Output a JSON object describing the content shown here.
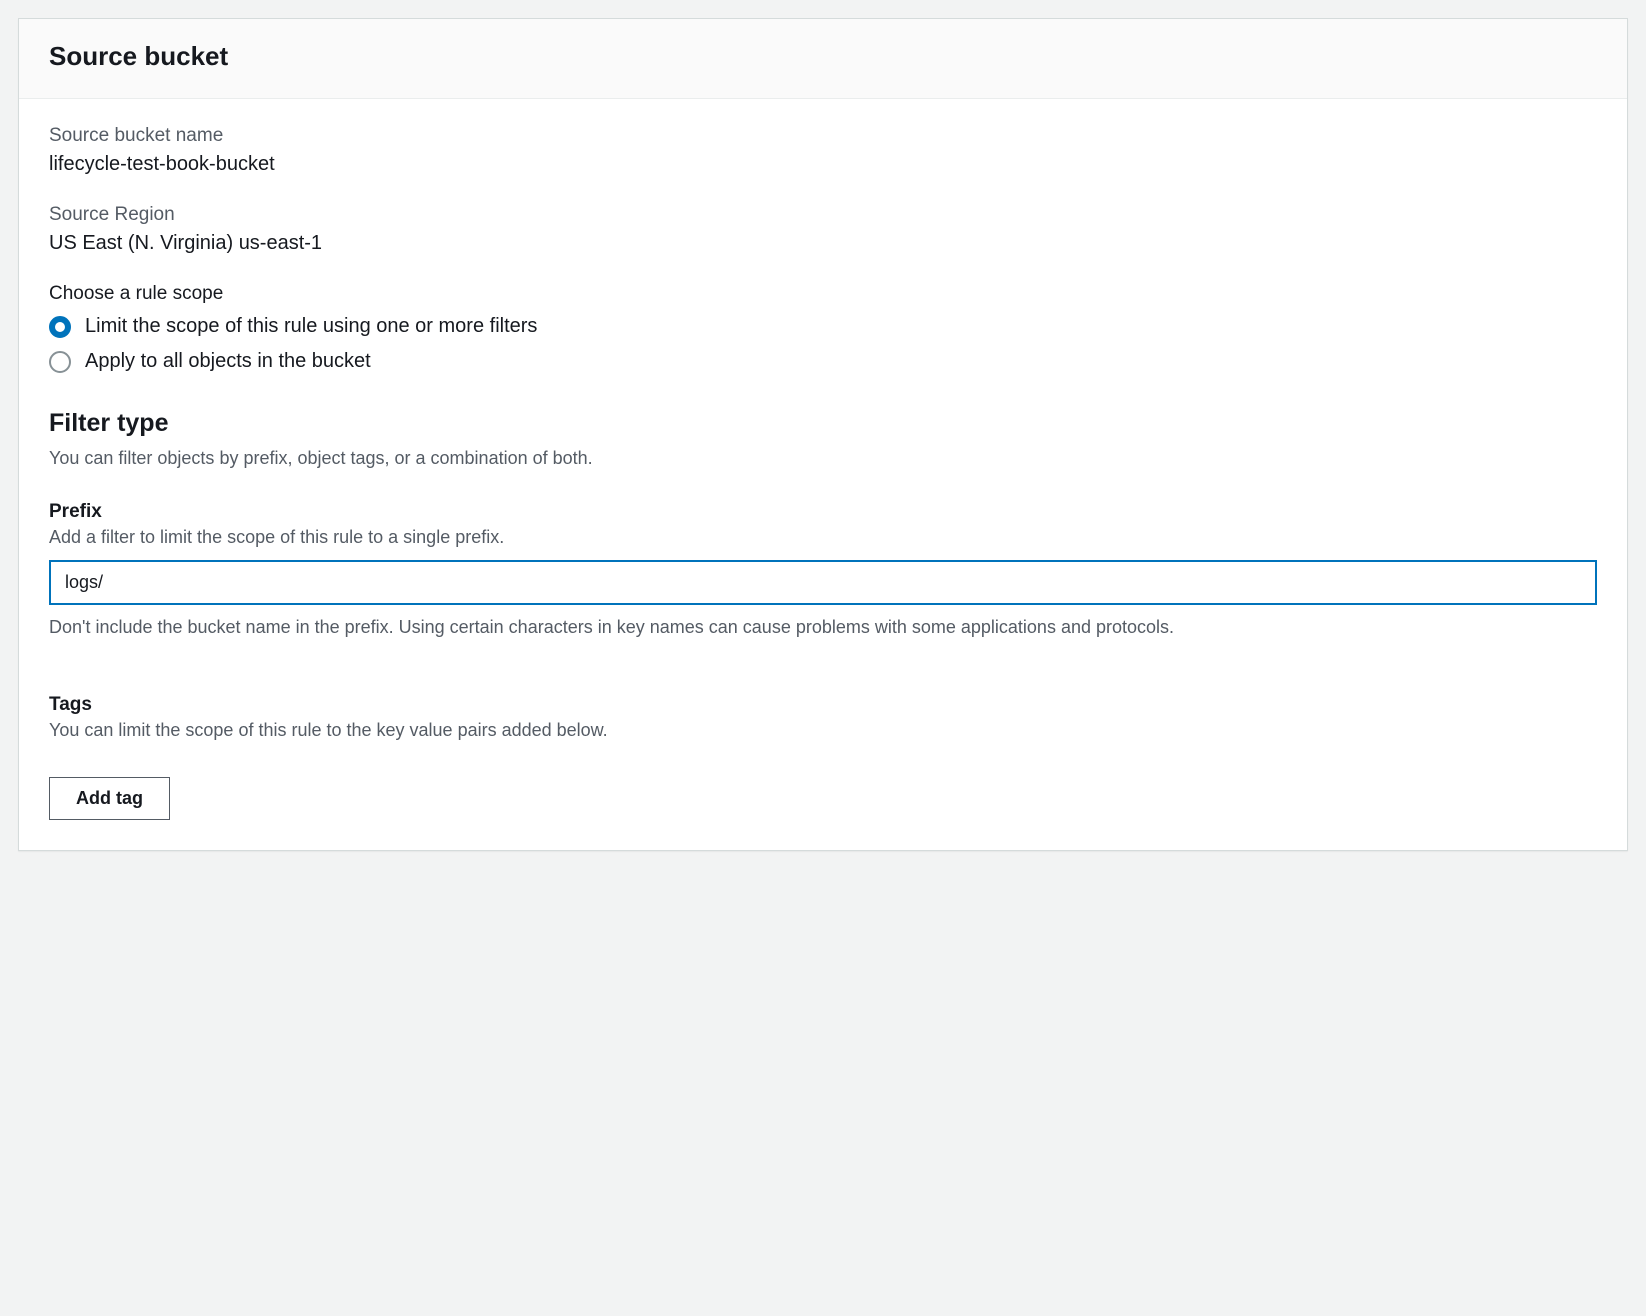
{
  "panel": {
    "title": "Source bucket"
  },
  "source_bucket": {
    "name_label": "Source bucket name",
    "name_value": "lifecycle-test-book-bucket",
    "region_label": "Source Region",
    "region_value": "US East (N. Virginia) us-east-1"
  },
  "scope": {
    "label": "Choose a rule scope",
    "options": [
      {
        "label": "Limit the scope of this rule using one or more filters",
        "selected": true
      },
      {
        "label": "Apply to all objects in the bucket",
        "selected": false
      }
    ]
  },
  "filter": {
    "heading": "Filter type",
    "desc": "You can filter objects by prefix, object tags, or a combination of both.",
    "prefix_label": "Prefix",
    "prefix_helper": "Add a filter to limit the scope of this rule to a single prefix.",
    "prefix_value": "logs/",
    "prefix_footnote": "Don't include the bucket name in the prefix. Using certain characters in key names can cause problems with some applications and protocols."
  },
  "tags": {
    "label": "Tags",
    "helper": "You can limit the scope of this rule to the key value pairs added below.",
    "add_button": "Add tag"
  }
}
